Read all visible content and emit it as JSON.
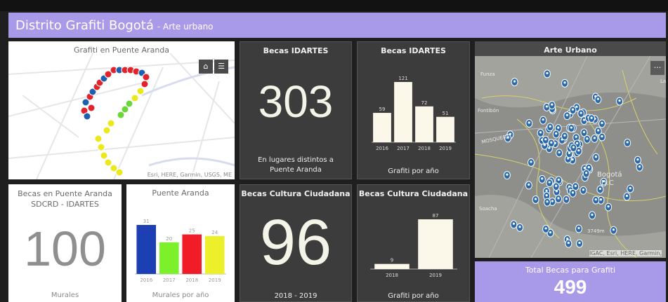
{
  "header": {
    "title": "Distrito Grafiti Bogotá",
    "subtitle": "- Arte urbano"
  },
  "map1": {
    "title": "Grafiti en Puente Aranda",
    "attribution": "Esri, HERE, Garmin, USGS, ME",
    "home_icon": "home-icon",
    "legend_icon": "legend-list-icon",
    "home_glyph": "⌂",
    "legend_glyph": "☰"
  },
  "becas_idartes_num": {
    "title": "Becas IDARTES",
    "value": "303",
    "caption": "En lugares distintos a Puente Aranda"
  },
  "becas_idartes_chart": {
    "title": "Becas IDARTES",
    "caption": "Grafiti por año",
    "chart_data": {
      "type": "bar",
      "categories": [
        "2016",
        "2017",
        "2018",
        "2019"
      ],
      "values": [
        59,
        121,
        72,
        51
      ],
      "ylim": [
        0,
        121
      ],
      "colors": [
        "#fbf8ea"
      ]
    }
  },
  "map2": {
    "title": "Arte Urbano",
    "more_glyph": "···",
    "attribution": "IGAC, Esri, HERE, Garmin,",
    "labels": [
      "Funza",
      "Fontibón",
      "MOSQUERA",
      "Bogotá",
      "D.C",
      "Soacha",
      "3749m",
      "La"
    ]
  },
  "becas_pa": {
    "title_line1": "Becas en Puente Aranda",
    "title_line2": "SDCRD - IDARTES",
    "value": "100",
    "caption": "Murales"
  },
  "puente_aranda_chart": {
    "title": "Puente Aranda",
    "caption": "Murales por año",
    "chart_data": {
      "type": "bar",
      "categories": [
        "2016",
        "2017",
        "2018",
        "2019"
      ],
      "values": [
        31,
        20,
        25,
        24
      ],
      "ylim": [
        0,
        31
      ],
      "colors": [
        "#1c3fb3",
        "#7cf02a",
        "#f01c28",
        "#ecf02a"
      ]
    }
  },
  "becas_cultura_num": {
    "title": "Becas Cultura Ciudadana",
    "value": "96",
    "caption": "2018 - 2019"
  },
  "becas_cultura_chart": {
    "title": "Becas Cultura Ciudadana",
    "caption": "Grafiti por año",
    "chart_data": {
      "type": "bar",
      "categories": [
        "2018",
        "2019"
      ],
      "values": [
        9,
        87
      ],
      "ylim": [
        0,
        87
      ],
      "colors": [
        "#fbf8ea"
      ]
    }
  },
  "total": {
    "label": "Total Becas para Grafiti",
    "value": "499"
  }
}
